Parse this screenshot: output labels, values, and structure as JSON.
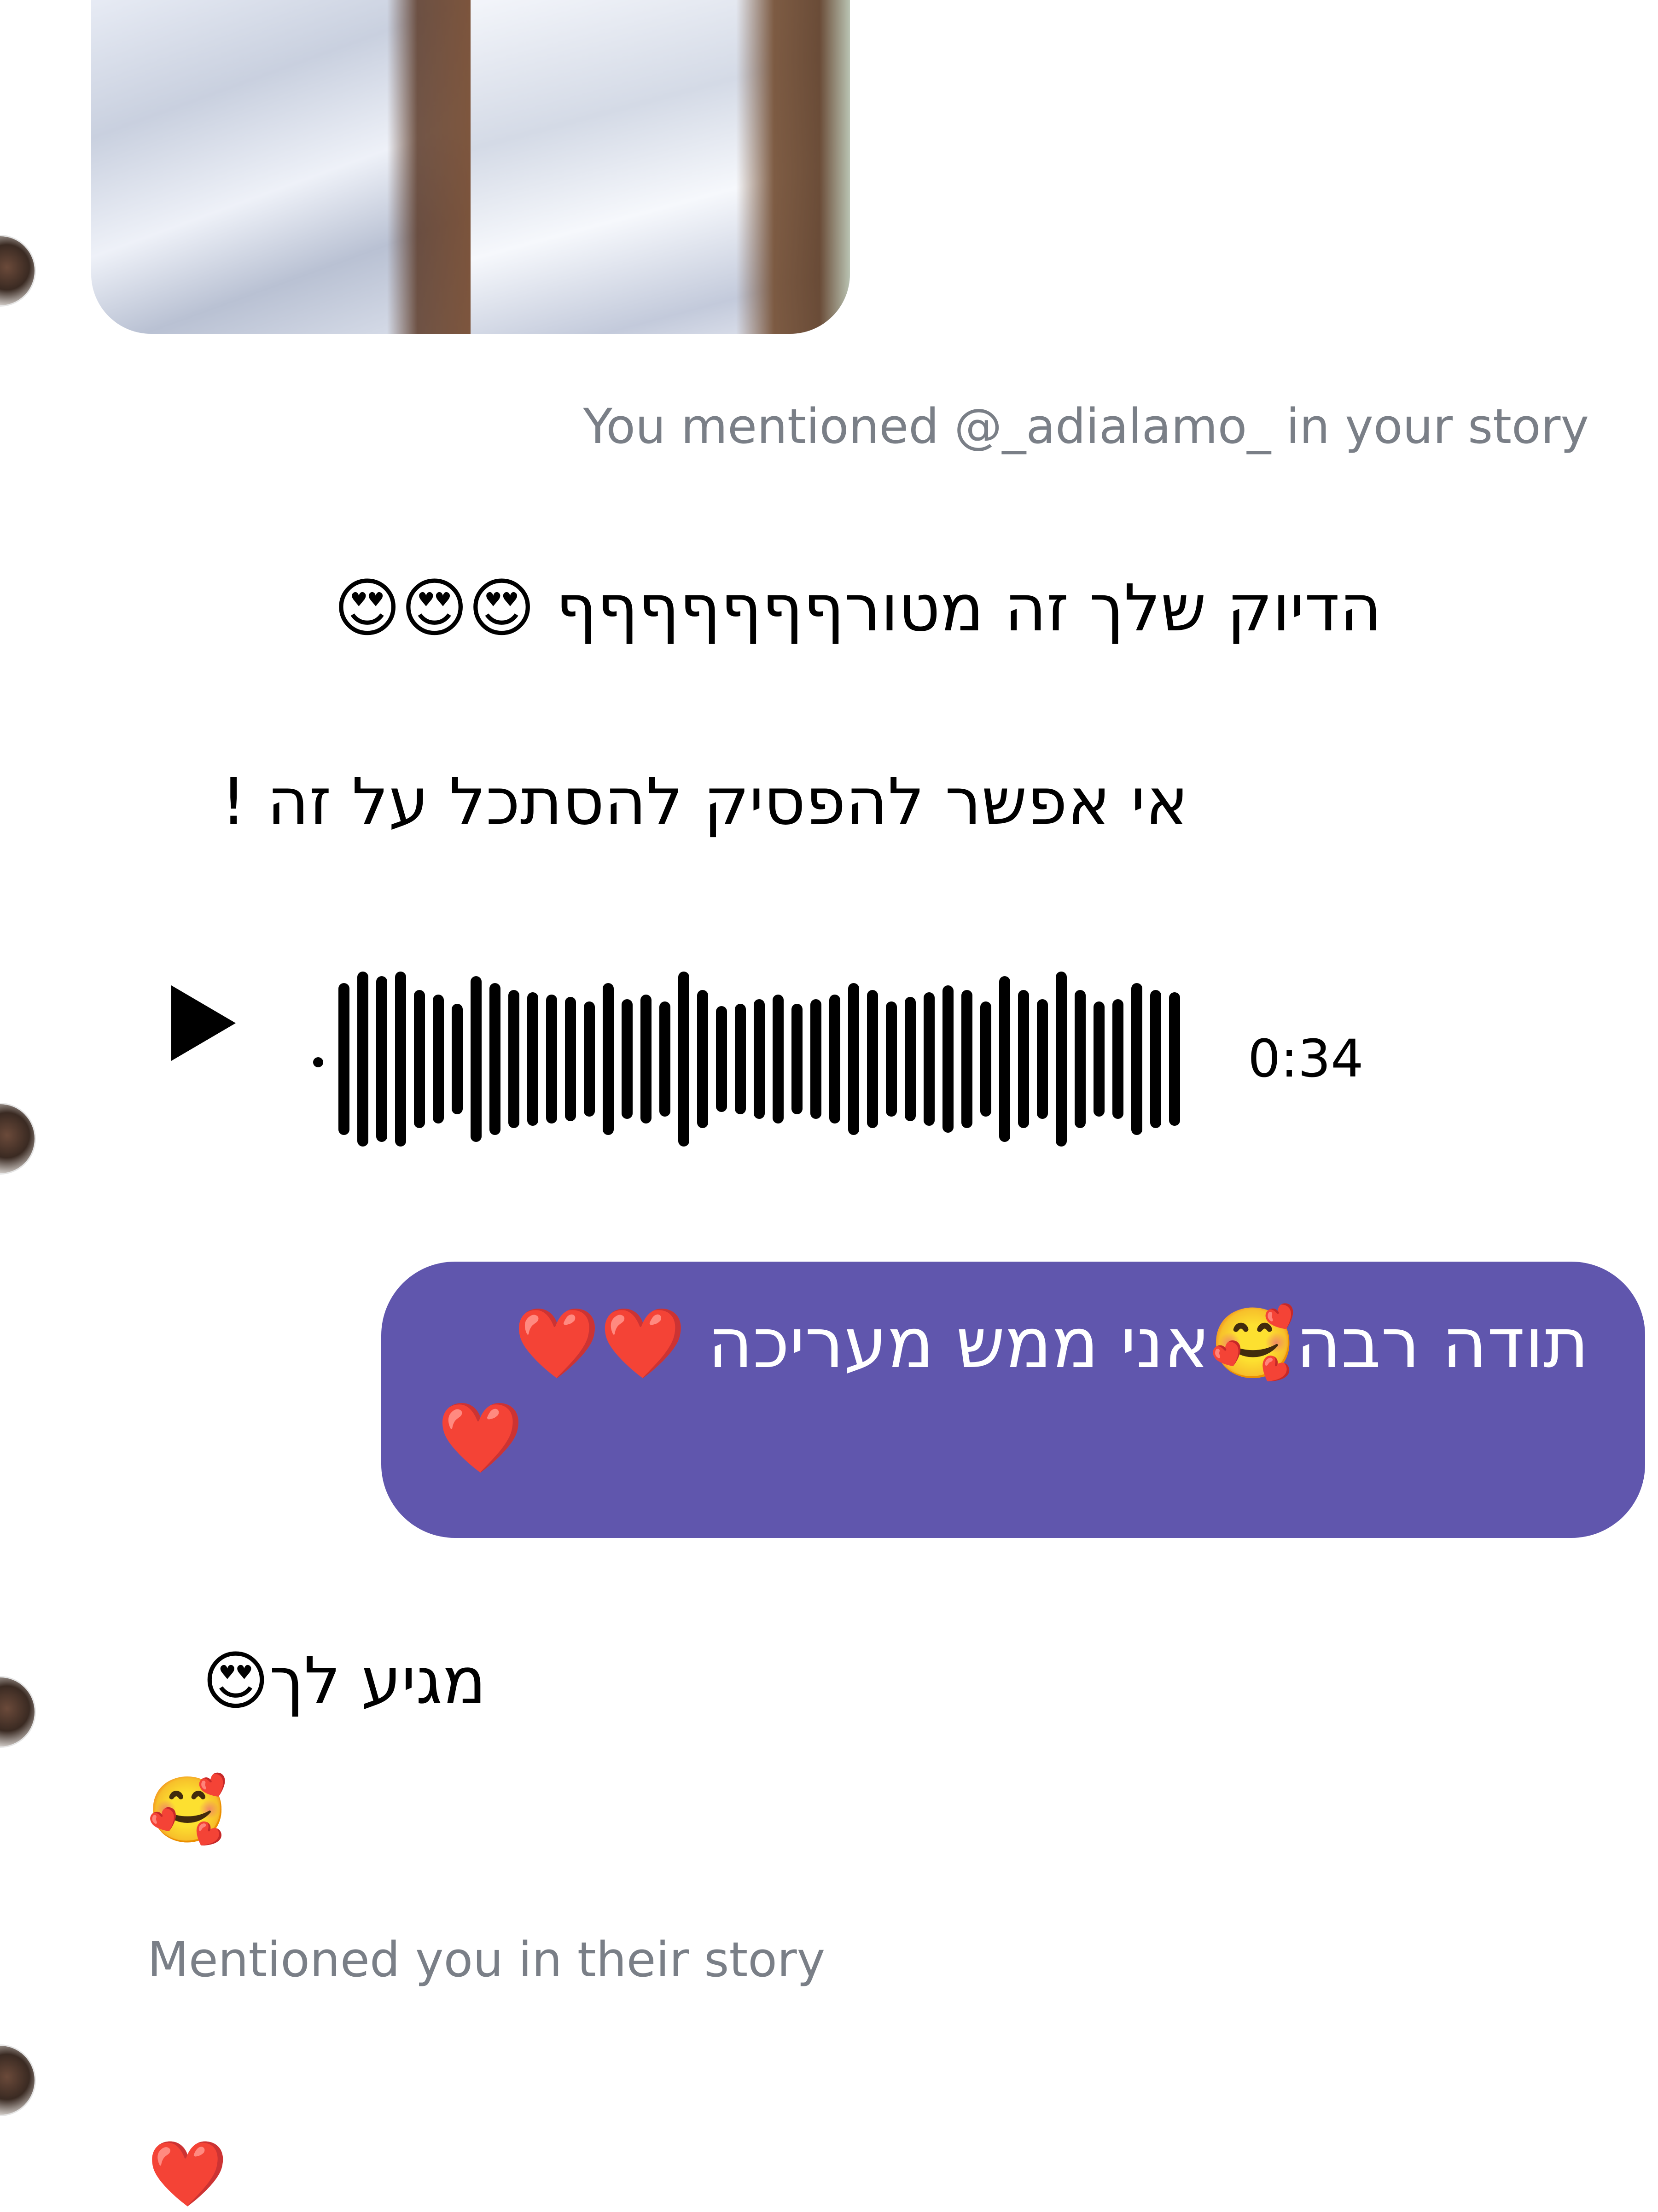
{
  "story_reply": {
    "image_alt": "story-photo"
  },
  "meta": {
    "you_mentioned": "You mentioned @_adialamo_ in your story",
    "mentioned_you": "Mentioned you in their story"
  },
  "messages": {
    "incoming_1": "הדיוק שלך זה מטורףףףףףףף 😍😍😍",
    "incoming_2": "אי אפשר להפסיק להסתכל על זה !",
    "voice_duration": "0:34",
    "outgoing_1_line1": "תודה רבה🥰אני ממש מעריכה ❤️❤️",
    "outgoing_1_line2": "❤️",
    "incoming_3": "מגיע לך😍",
    "incoming_4": "🥰",
    "incoming_5": "❤️"
  },
  "colors": {
    "outgoing_bubble": "#6056ad",
    "meta_text": "#7a7f87",
    "background": "#ffffff"
  },
  "icons": {
    "play": "play-icon",
    "avatar": "contact-avatar"
  }
}
